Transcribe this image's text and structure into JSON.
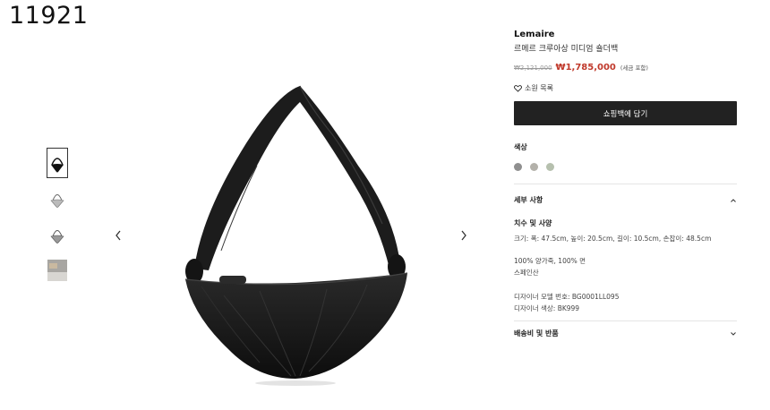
{
  "page_id": "11921",
  "product": {
    "brand": "Lemaire",
    "name": "르메르 크루아상 미디엄 숄더백",
    "original_price": "₩2,121,000",
    "sale_price": "₩1,785,000",
    "tax_note": "(세금 포함)",
    "wishlist_label": "소원 목록",
    "add_to_cart_label": "쇼핑백에 담기",
    "color_label": "색상",
    "colors": [
      "#8f8f8f",
      "#b3b1aa",
      "#b6c0ae"
    ]
  },
  "details": {
    "title": "세부 사항",
    "size_title": "치수 및 사양",
    "size_text": "크기: 폭: 47.5cm, 높이: 20.5cm, 길이: 10.5cm, 손잡이: 48.5cm",
    "material": "100% 양가죽, 100% 면",
    "origin": "스페인산",
    "model_no": "디자이너 모델 번호: BG0001LL095",
    "designer_color": "디자이너 색상: BK999"
  },
  "shipping": {
    "title": "배송비 및 반품"
  },
  "icons": {
    "prev": "chevron-left-icon",
    "next": "chevron-right-icon",
    "wishlist": "heart-icon",
    "expand": "chevron-up-icon",
    "collapse": "chevron-down-icon"
  }
}
